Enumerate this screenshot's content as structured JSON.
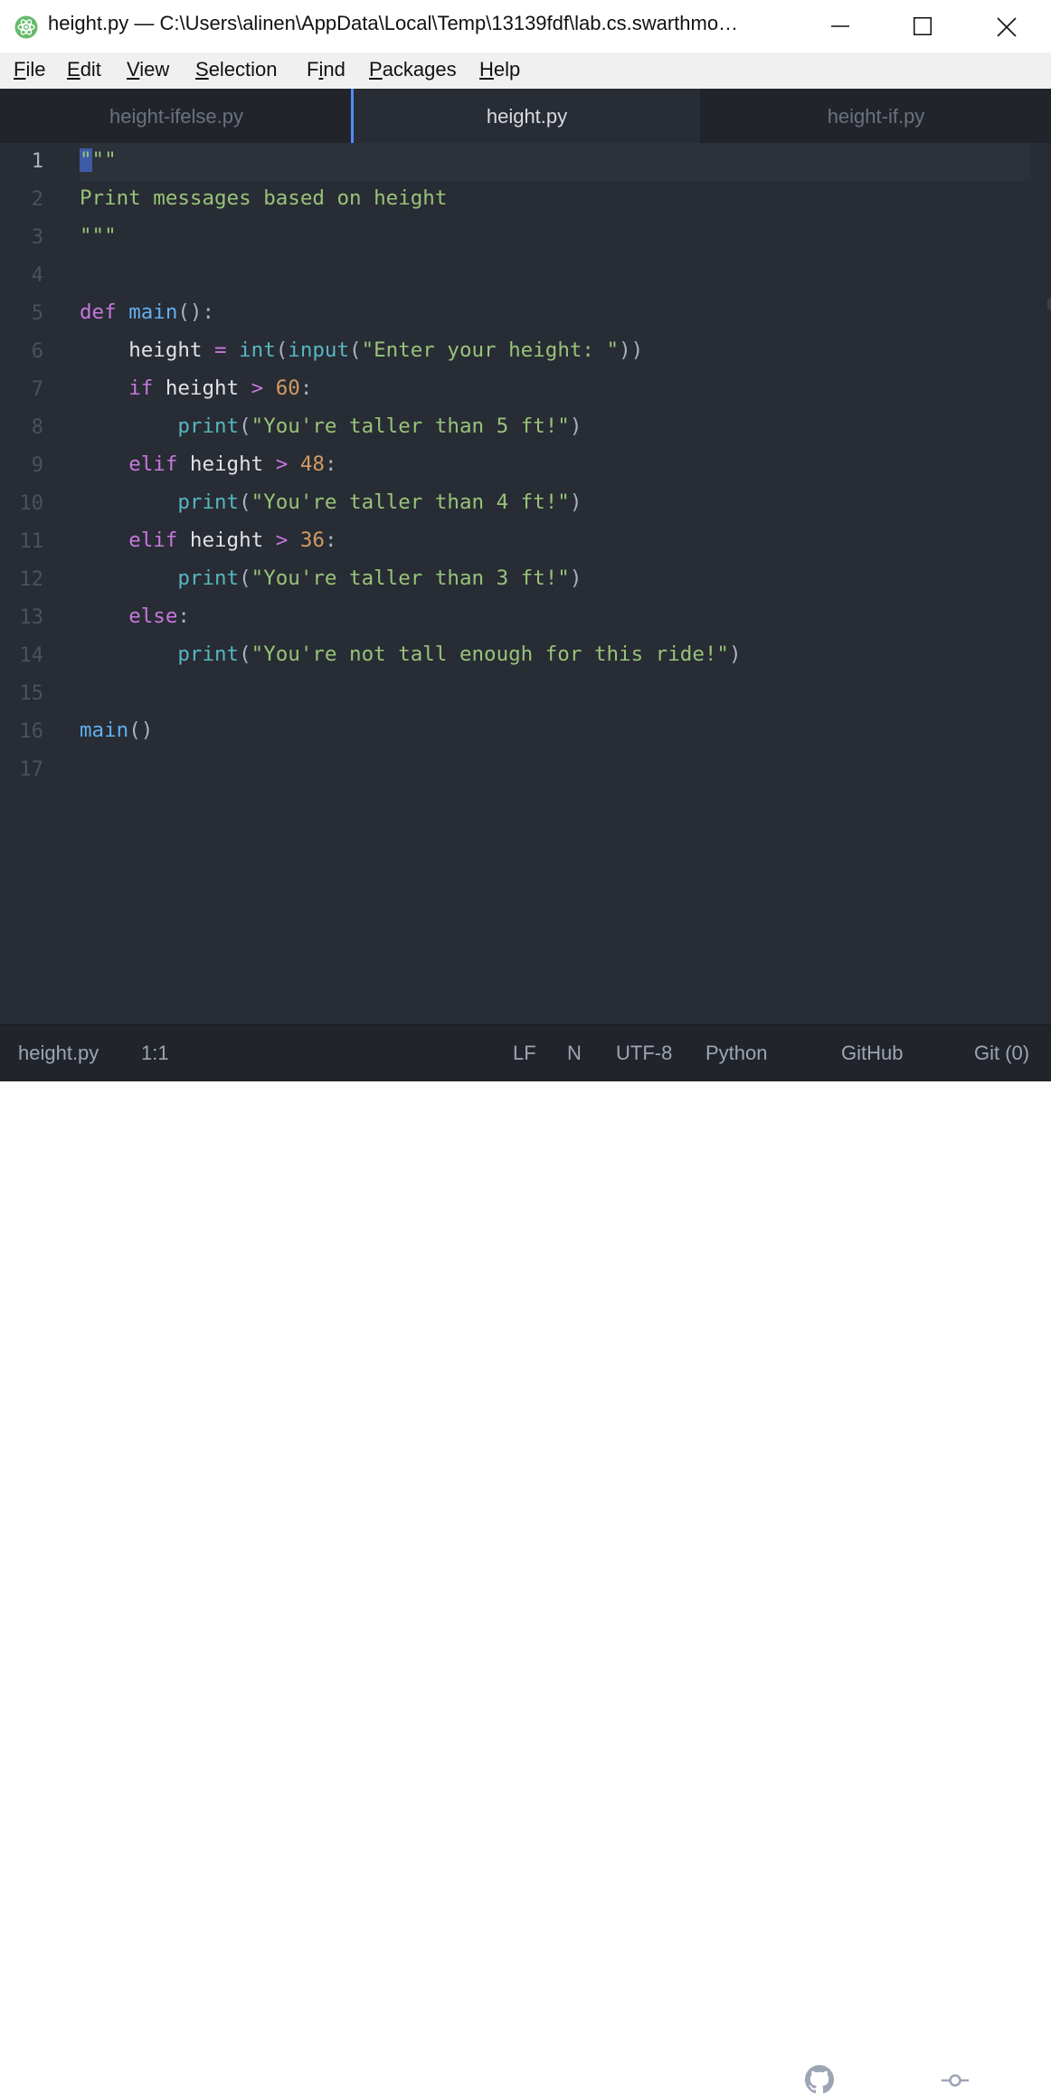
{
  "window": {
    "title": "height.py — C:\\Users\\alinen\\AppData\\Local\\Temp\\13139fdf\\lab.cs.swarthmo…",
    "icon": "atom-icon"
  },
  "menu": [
    {
      "label": "File",
      "accel": "F",
      "rest": "ile"
    },
    {
      "label": "Edit",
      "accel": "E",
      "rest": "dit"
    },
    {
      "label": "View",
      "accel": "V",
      "rest": "iew"
    },
    {
      "label": "Selection",
      "accel": "S",
      "rest": "election"
    },
    {
      "label": "Find",
      "pre": "F",
      "accel": "i",
      "rest": "nd"
    },
    {
      "label": "Packages",
      "accel": "P",
      "rest": "ackages"
    },
    {
      "label": "Help",
      "accel": "H",
      "rest": "elp"
    }
  ],
  "tabs": [
    {
      "label": "height-ifelse.py",
      "active": false
    },
    {
      "label": "height.py",
      "active": true
    },
    {
      "label": "height-if.py",
      "active": false
    }
  ],
  "editor": {
    "line_numbers": [
      "1",
      "2",
      "3",
      "4",
      "5",
      "6",
      "7",
      "8",
      "9",
      "10",
      "11",
      "12",
      "13",
      "14",
      "15",
      "16",
      "17"
    ],
    "active_line": "1",
    "code": [
      "\"\"\"",
      "Print messages based on height",
      "\"\"\"",
      "",
      "def main():",
      "    height = int(input(\"Enter your height: \"))",
      "    if height > 60:",
      "        print(\"You're taller than 5 ft!\")",
      "    elif height > 48:",
      "        print(\"You're taller than 4 ft!\")",
      "    elif height > 36:",
      "        print(\"You're taller than 3 ft!\")",
      "    else:",
      "        print(\"You're not tall enough for this ride!\")",
      "",
      "main()",
      ""
    ]
  },
  "status": {
    "file": "height.py",
    "cursor": "1:1",
    "line_ending": "LF",
    "indent": "N",
    "encoding": "UTF-8",
    "grammar": "Python",
    "github": "GitHub",
    "git": "Git (0)"
  },
  "colors": {
    "editor_bg": "#282c34",
    "tabbar_bg": "#21252b",
    "keyword": "#c678dd",
    "function": "#61afef",
    "builtin": "#56b6c2",
    "string": "#98c379",
    "number": "#d19a66",
    "accent": "#528bff"
  }
}
